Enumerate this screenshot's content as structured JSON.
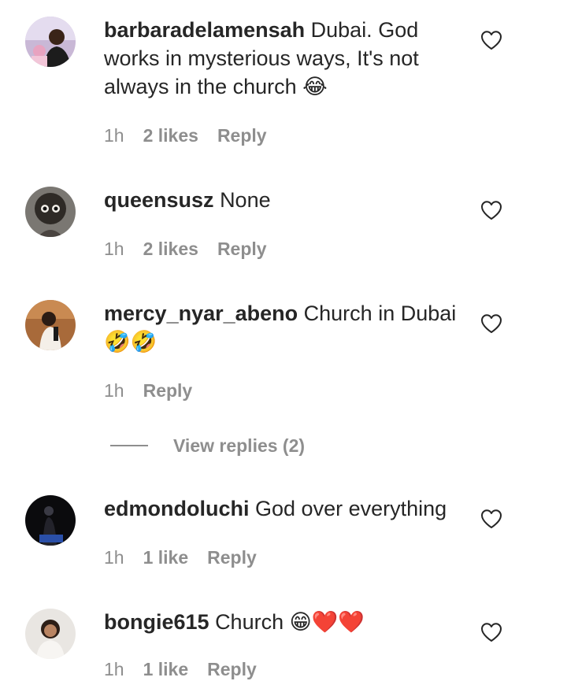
{
  "comments": [
    {
      "username": "barbaradelamensah",
      "text": "Dubai. God works in mysterious ways, It's not always in the church",
      "emoji": "😂",
      "time": "1h",
      "likes": "2 likes",
      "reply": "Reply",
      "avatar_icon": "profile-photo",
      "heart_icon": "heart-outline-icon"
    },
    {
      "username": "queensusz",
      "text": "None",
      "emoji": "",
      "time": "1h",
      "likes": "2 likes",
      "reply": "Reply",
      "avatar_icon": "profile-photo",
      "heart_icon": "heart-outline-icon"
    },
    {
      "username": "mercy_nyar_abeno",
      "text": "Church in Dubai",
      "emoji": "🤣🤣",
      "time": "1h",
      "likes": "",
      "reply": "Reply",
      "avatar_icon": "profile-photo",
      "heart_icon": "heart-outline-icon"
    },
    {
      "username": "edmondoluchi",
      "text": "God over everything",
      "emoji": "",
      "time": "1h",
      "likes": "1 like",
      "reply": "Reply",
      "avatar_icon": "profile-photo",
      "heart_icon": "heart-outline-icon"
    },
    {
      "username": "bongie615",
      "text": "Church",
      "emoji": "😁❤️❤️",
      "time": "1h",
      "likes": "1 like",
      "reply": "Reply",
      "avatar_icon": "profile-photo",
      "heart_icon": "heart-outline-icon"
    }
  ],
  "view_replies": {
    "label": "View replies (2)"
  },
  "colors": {
    "text": "#262626",
    "meta": "#8e8e8e",
    "background": "#ffffff"
  }
}
